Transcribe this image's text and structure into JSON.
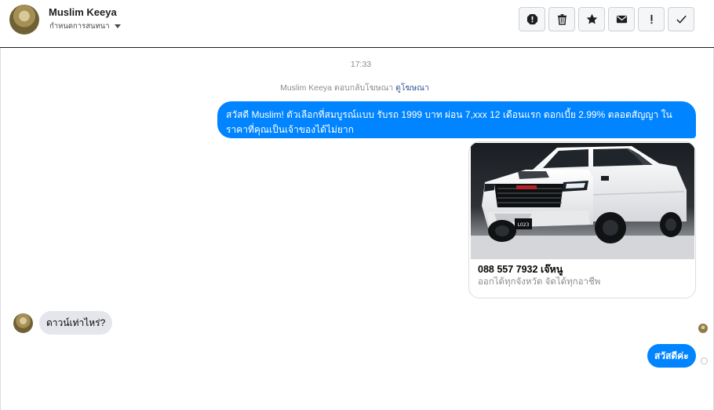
{
  "header": {
    "contact_name": "Muslim Keeya",
    "label_dropdown": "กำหนดการสนทนา",
    "toolbar": [
      {
        "icon": "spam-icon",
        "label": "spam"
      },
      {
        "icon": "trash-icon",
        "label": "delete"
      },
      {
        "icon": "star-icon",
        "label": "star"
      },
      {
        "icon": "envelope-icon",
        "label": "mark unread"
      },
      {
        "icon": "exclamation-icon",
        "label": "follow up"
      },
      {
        "icon": "checkmark-icon",
        "label": "done"
      }
    ]
  },
  "conversation": {
    "timestamp": "17:33",
    "system_message": {
      "text": "Muslim Keeya ตอบกลับโฆษณา",
      "link": "ดูโฆษณา"
    },
    "outgoing_message": "สวัสดี Muslim! ตัวเลือกที่สมบูรณ์แบบ รับรถ 1999 บาท ผ่อน 7,xxx 12 เดือนแรก ดอกเบี้ย 2.99% ตลอดสัญญา ในราคาที่คุณเป็นเจ้าของได้ไม่ยาก",
    "ad_card": {
      "image": "white pickup truck photo",
      "plate_text": "L023",
      "title": "088 557 7932 เจ๊หนู",
      "subtitle": "ออกได้ทุกจังหวัด จัดได้ทุกอาชีพ"
    },
    "incoming_message": "ดาวน์เท่าไหร่?",
    "outgoing_reply": "สวัสดีค่ะ"
  },
  "colors": {
    "messenger_blue": "#0084ff",
    "incoming_bubble": "#e4e6eb",
    "meta_text": "#8a8d91",
    "link": "#385898"
  }
}
